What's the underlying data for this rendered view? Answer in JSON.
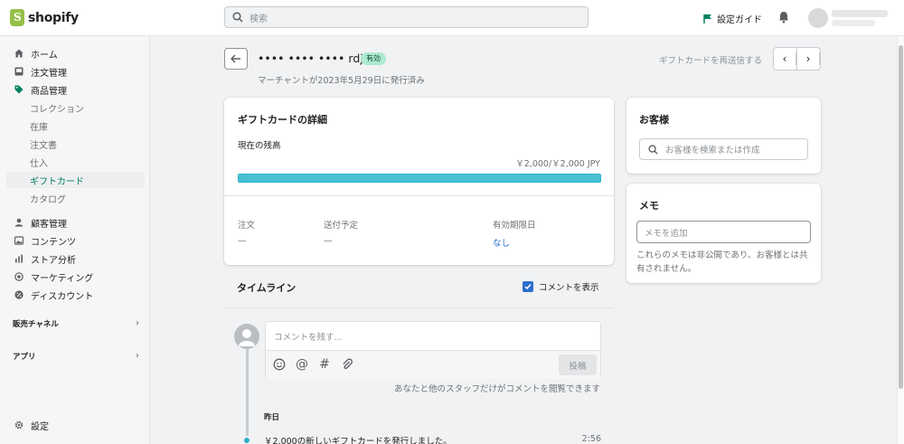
{
  "app": {
    "brand": "shopify"
  },
  "topbar": {
    "search_placeholder": "検索",
    "setup_guide": "設定ガイド"
  },
  "sidebar": {
    "items": [
      {
        "label": "ホーム",
        "icon": "home-icon"
      },
      {
        "label": "注文管理",
        "icon": "inbox-icon"
      },
      {
        "label": "商品管理",
        "icon": "tag-icon"
      }
    ],
    "sub_items": [
      {
        "label": "コレクション"
      },
      {
        "label": "在庫"
      },
      {
        "label": "注文書"
      },
      {
        "label": "仕入"
      },
      {
        "label": "ギフトカード",
        "active": true
      },
      {
        "label": "カタログ"
      }
    ],
    "items2": [
      {
        "label": "顧客管理",
        "icon": "person-icon"
      },
      {
        "label": "コンテンツ",
        "icon": "image-icon"
      },
      {
        "label": "ストア分析",
        "icon": "analytics-icon"
      },
      {
        "label": "マーケティング",
        "icon": "target-icon"
      },
      {
        "label": "ディスカウント",
        "icon": "discount-icon"
      }
    ],
    "sales_channels": "販売チャネル",
    "apps": "アプリ",
    "settings": "設定"
  },
  "header": {
    "title": "•••• •••• •••• rdjh",
    "status": "有効",
    "issued": "マーチャントが2023年5月29日に発行済み",
    "resend": "ギフトカードを再送信する"
  },
  "details": {
    "title": "ギフトカードの詳細",
    "balance_label": "現在の残高",
    "balance_value": "￥2,000/￥2,000 JPY",
    "balance_fraction": 1.0,
    "order_label": "注文",
    "order_value": "—",
    "scheduled_label": "送付予定",
    "scheduled_value": "—",
    "expiry_label": "有効期限日",
    "expiry_value": "なし"
  },
  "customer": {
    "title": "お客様",
    "search_placeholder": "お客様を検索または作成"
  },
  "memo": {
    "title": "メモ",
    "placeholder": "メモを追加",
    "help": "これらのメモは非公開であり、お客様とは共有されません。"
  },
  "timeline": {
    "title": "タイムライン",
    "show_comments": "コメントを表示",
    "comment_placeholder": "コメントを残す...",
    "post_label": "投稿",
    "staff_note": "あなたと他のスタッフだけがコメントを閲覧できます",
    "date_label": "昨日",
    "event_text": "￥2,000の新しいギフトカードを発行しました。",
    "event_time": "2:56"
  },
  "colors": {
    "accent": "#008060",
    "progress": "#47c1d2",
    "badge_bg": "#aee9d1",
    "link": "#2c6ecb"
  }
}
